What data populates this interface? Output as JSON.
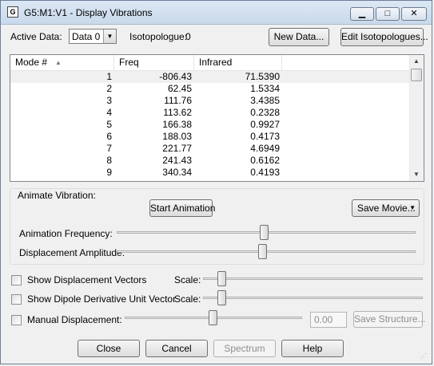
{
  "window": {
    "title": "G5:M1:V1 - Display Vibrations"
  },
  "header": {
    "active_data_label": "Active Data:",
    "active_data_value": "Data 0",
    "isotopologue_label": "Isotopologue:",
    "isotopologue_value": "0",
    "new_data_label": "New Data...",
    "edit_isotopologues_label": "Edit Isotopologues..."
  },
  "table": {
    "columns": [
      "Mode #",
      "Freq",
      "Infrared"
    ],
    "rows": [
      [
        "1",
        "-806.43",
        "71.5390"
      ],
      [
        "2",
        "62.45",
        "1.5334"
      ],
      [
        "3",
        "111.76",
        "3.4385"
      ],
      [
        "4",
        "113.62",
        "0.2328"
      ],
      [
        "5",
        "166.38",
        "0.9927"
      ],
      [
        "6",
        "188.03",
        "0.4173"
      ],
      [
        "7",
        "221.77",
        "4.6949"
      ],
      [
        "8",
        "241.43",
        "0.6162"
      ],
      [
        "9",
        "340.34",
        "0.4193"
      ]
    ]
  },
  "animate": {
    "group_label": "Animate Vibration:",
    "start_label": "Start Animation",
    "save_movie_label": "Save Movie...",
    "frequency_label": "Animation Frequency:",
    "amplitude_label": "Displacement Amplitude:"
  },
  "options": {
    "displacement_vectors_label": "Show Displacement Vectors",
    "dipole_label": "Show Dipole Derivative Unit Vector",
    "manual_label": "Manual Displacement:",
    "scale_label": "Scale:",
    "manual_value": "0.00",
    "save_structure_label": "Save Structure..."
  },
  "footer": {
    "close_label": "Close",
    "cancel_label": "Cancel",
    "spectrum_label": "Spectrum",
    "help_label": "Help"
  }
}
